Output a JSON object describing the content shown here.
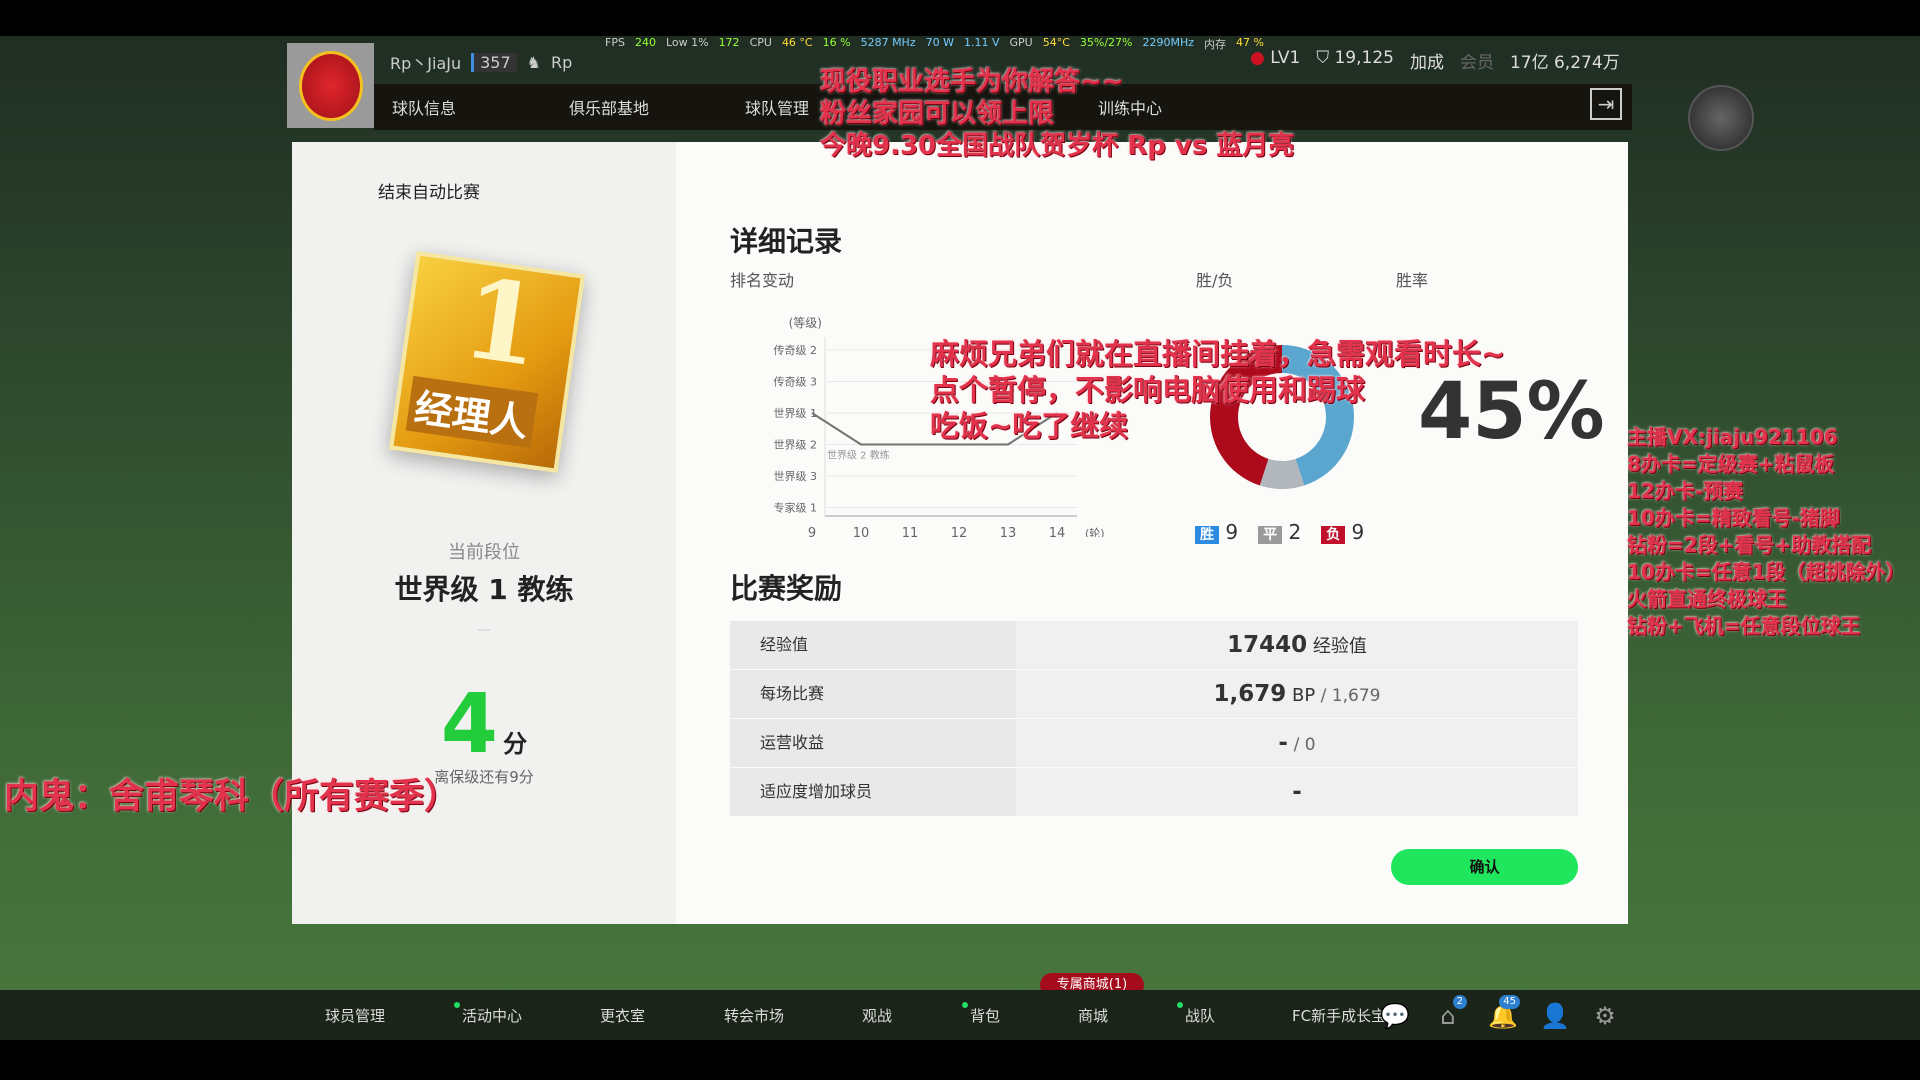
{
  "hud": {
    "fps_label": "FPS",
    "fps": "240",
    "low_label": "Low 1%",
    "low": "172",
    "cpu_label": "CPU",
    "cpu_temp": "46 °C",
    "cpu_use": "16 %",
    "cpu_clock": "5287 MHz",
    "power": "70 W",
    "volt": "1.11 V",
    "gpu_label": "GPU",
    "gpu_temp": "54°C",
    "gpu_use": "35%/27%",
    "gpu_clock": "2290MHz",
    "mem_label": "内存",
    "mem": "47 %"
  },
  "header": {
    "team": "Rp丶JiaJu",
    "team_level": "357",
    "club": "Rp",
    "level": "LV1",
    "points": "19,125",
    "bonus": "加成",
    "member": "会员",
    "coins": "17亿 6,274万"
  },
  "nav": [
    "球队信息",
    "俱乐部基地",
    "球队管理",
    "训练中心"
  ],
  "modal": {
    "end_auto": "结束自动比赛",
    "badge": {
      "number": "1",
      "text": "经理人"
    },
    "current_rank_label": "当前段位",
    "current_rank": "世界级 1 教练",
    "dash": "—",
    "score": "4",
    "score_unit": "分",
    "relegation_note": "离保级还有9分",
    "detail_title": "详细记录",
    "rank_change_label": "排名变动",
    "wl_label": "胜/负",
    "winrate_label": "胜率",
    "winrate": "45%",
    "rewards_title": "比赛奖励",
    "rewards": [
      {
        "label": "经验值",
        "value": "17440",
        "unit": "经验值"
      },
      {
        "label": "每场比赛",
        "value": "1,679",
        "unit": "BP",
        "extra": " / 1,679"
      },
      {
        "label": "运营收益",
        "value": "-",
        "unit": "",
        "extra": " / 0"
      },
      {
        "label": "适应度增加球员",
        "value": "-",
        "unit": "",
        "extra": ""
      }
    ],
    "confirm": "确认"
  },
  "chart_data": [
    {
      "type": "line",
      "ylabel": "(等级)",
      "xlabel": "(轮)",
      "yticks": [
        "传奇级 2",
        "传奇级 3",
        "世界级 1",
        "世界级 2",
        "世界级 3",
        "专家级 1"
      ],
      "x": [
        9,
        10,
        11,
        12,
        13,
        14
      ],
      "values": [
        "世界级 1",
        "世界级 2",
        "世界级 2",
        "世界级 2",
        "世界级 2",
        "世界级 1"
      ],
      "annotation": "世界级 2 教练",
      "color": "#707470"
    },
    {
      "type": "pie",
      "donut": true,
      "series": [
        {
          "name": "胜",
          "value": 9,
          "color": "#5aa6cf"
        },
        {
          "name": "平",
          "value": 2,
          "color": "#b2b6bd"
        },
        {
          "name": "负",
          "value": 9,
          "color": "#ad0a1c"
        }
      ],
      "legend_colors": {
        "胜": "#2b8be0",
        "平": "#9a9a9a",
        "负": "#c0102a"
      }
    }
  ],
  "overlays": {
    "top": [
      "现役职业选手为你解答~~",
      "粉丝家园可以领上限",
      "今晚9.30全国战队贺岁杯 Rp vs 蓝月亮"
    ],
    "middle": [
      "麻烦兄弟们就在直播间挂着，急需观看时长~",
      "点个暂停，不影响电脑使用和踢球",
      "吃饭~吃了继续"
    ],
    "left": "内鬼：舍甫琴科（所有赛季）",
    "right": [
      "主播VX:jiaju921106",
      "8办卡=定级赛+粘鼠板",
      "12办卡-预赛",
      "10办卡=精致看号-猪脚",
      "钻粉=2段+看号+助教搭配",
      "10办卡=任意1段（超挑除外）",
      "火箭直通终极球王",
      "钻粉+飞机=任意段位球王"
    ]
  },
  "bottom": {
    "items": [
      "球员管理",
      "活动中心",
      "更衣室",
      "转会市场",
      "观战",
      "背包",
      "商城",
      "战队",
      "FC新手成长宝"
    ],
    "mall_badge": "专属商城(1)",
    "mail_count": "2",
    "notif_count": "45"
  }
}
